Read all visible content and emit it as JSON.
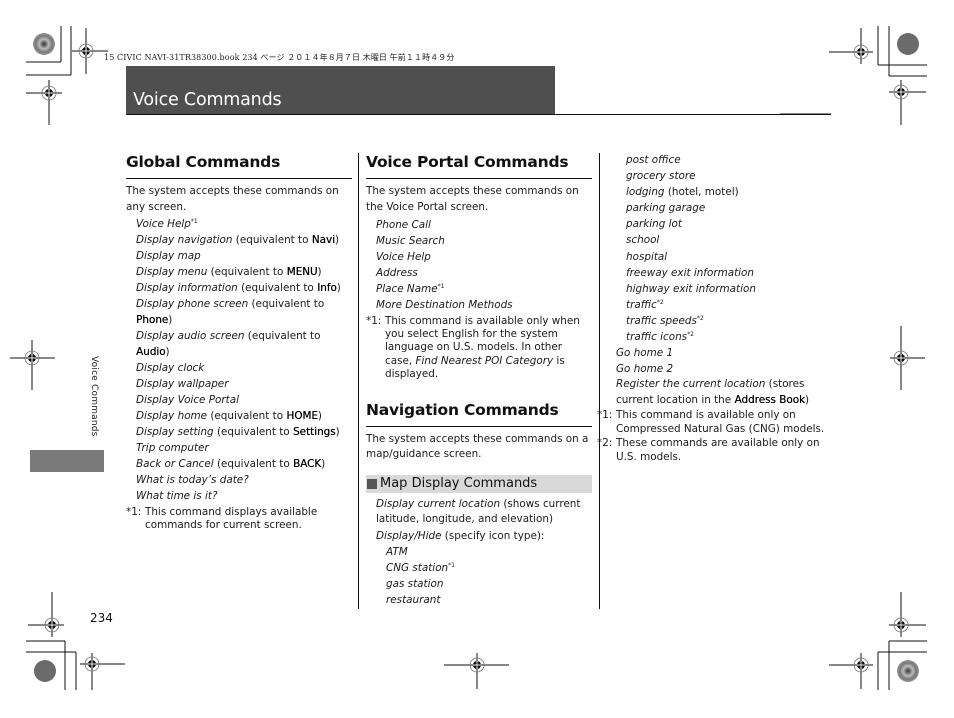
{
  "print_header": "15 CIVIC NAVI-31TR38300.book  234 ページ  ２０１４年８月７日  木曜日  午前１１時４９分",
  "page_title": "Voice Commands",
  "side_tab": "Voice Commands",
  "page_number": "234",
  "global": {
    "heading": "Global Commands",
    "intro": "The system accepts these commands on any screen.",
    "items": [
      {
        "cmd": "Voice Help",
        "sup": "*1",
        "pre": "",
        "key": "",
        "post": ""
      },
      {
        "cmd": "Display navigation",
        "sup": "",
        "pre": " (equivalent to ",
        "key": "Navi",
        "post": ")"
      },
      {
        "cmd": "Display map",
        "sup": "",
        "pre": "",
        "key": "",
        "post": ""
      },
      {
        "cmd": "Display menu",
        "sup": "",
        "pre": " (equivalent to ",
        "key": "MENU",
        "post": ")"
      },
      {
        "cmd": "Display information",
        "sup": "",
        "pre": " (equivalent to ",
        "key": "Info",
        "post": ")"
      },
      {
        "cmd": "Display phone screen",
        "sup": "",
        "pre": " (equivalent to ",
        "key": "Phone",
        "post": ")"
      },
      {
        "cmd": "Display audio screen",
        "sup": "",
        "pre": " (equivalent to ",
        "key": "Audio",
        "post": ")"
      },
      {
        "cmd": "Display clock",
        "sup": "",
        "pre": "",
        "key": "",
        "post": ""
      },
      {
        "cmd": "Display wallpaper",
        "sup": "",
        "pre": "",
        "key": "",
        "post": ""
      },
      {
        "cmd": "Display Voice Portal",
        "sup": "",
        "pre": "",
        "key": "",
        "post": ""
      },
      {
        "cmd": "Display home",
        "sup": "",
        "pre": " (equivalent to ",
        "key": "HOME",
        "post": ")"
      },
      {
        "cmd": "Display setting",
        "sup": "",
        "pre": " (equivalent to ",
        "key": "Settings",
        "post": ")"
      },
      {
        "cmd": "Trip computer",
        "sup": "",
        "pre": "",
        "key": "",
        "post": ""
      },
      {
        "cmd": "Back or Cancel",
        "sup": "",
        "pre": " (equivalent to ",
        "key": "BACK",
        "post": ")"
      },
      {
        "cmd": "What is today’s date?",
        "sup": "",
        "pre": "",
        "key": "",
        "post": ""
      },
      {
        "cmd": "What time is it?",
        "sup": "",
        "pre": "",
        "key": "",
        "post": ""
      }
    ],
    "note_mark": "*1:",
    "note_text": "This command displays available commands for current screen."
  },
  "portal": {
    "heading": "Voice Portal Commands",
    "intro": "The system accepts these commands on the Voice Portal screen.",
    "items": [
      {
        "cmd": "Phone Call",
        "sup": ""
      },
      {
        "cmd": "Music Search",
        "sup": ""
      },
      {
        "cmd": "Voice Help",
        "sup": ""
      },
      {
        "cmd": "Address",
        "sup": ""
      },
      {
        "cmd": "Place Name",
        "sup": "*1"
      },
      {
        "cmd": "More Destination Methods",
        "sup": ""
      }
    ],
    "note_mark": "*1:",
    "note_text_a": "This command is available only when you select English for the system language on U.S. models. In other case, ",
    "note_text_it": "Find Nearest POI Category",
    "note_text_b": " is displayed."
  },
  "navigation": {
    "heading": "Navigation Commands",
    "intro": "The system accepts these commands on a map/guidance screen.",
    "subheading": "Map Display Commands",
    "current_location_cmd": "Display current location",
    "current_location_desc": " (shows current latitude, longitude, and elevation)",
    "display_hide_cmd": "Display/Hide",
    "display_hide_desc": " (specify icon type):",
    "icon_types": [
      {
        "cmd": "ATM",
        "sup": "",
        "desc": ""
      },
      {
        "cmd": "CNG station",
        "sup": "*1",
        "desc": ""
      },
      {
        "cmd": "gas station",
        "sup": "",
        "desc": ""
      },
      {
        "cmd": "restaurant",
        "sup": "",
        "desc": ""
      },
      {
        "cmd": "post office",
        "sup": "",
        "desc": ""
      },
      {
        "cmd": "grocery store",
        "sup": "",
        "desc": ""
      },
      {
        "cmd": "lodging",
        "sup": "",
        "desc": " (hotel, motel)"
      },
      {
        "cmd": "parking garage",
        "sup": "",
        "desc": ""
      },
      {
        "cmd": "parking lot",
        "sup": "",
        "desc": ""
      },
      {
        "cmd": "school",
        "sup": "",
        "desc": ""
      },
      {
        "cmd": "hospital",
        "sup": "",
        "desc": ""
      },
      {
        "cmd": "freeway exit information",
        "sup": "",
        "desc": ""
      },
      {
        "cmd": "highway exit information",
        "sup": "",
        "desc": ""
      },
      {
        "cmd": "traffic",
        "sup": "*2",
        "desc": ""
      },
      {
        "cmd": "traffic speeds",
        "sup": "*2",
        "desc": ""
      },
      {
        "cmd": "traffic icons",
        "sup": "*2",
        "desc": ""
      }
    ],
    "more": [
      {
        "cmd": "Go home 1"
      },
      {
        "cmd": "Go home 2"
      }
    ],
    "register_cmd": "Register the current location",
    "register_pre": " (stores current location in the ",
    "register_key": "Address Book",
    "register_post": ")",
    "notes": [
      {
        "mark": "*1:",
        "text": "This command is available only on Compressed Natural Gas (CNG) models."
      },
      {
        "mark": "*2:",
        "text": "These commands are available only on U.S. models."
      }
    ]
  },
  "colors": {
    "title_bar": "#4f4f4f",
    "subhead_bg": "#d9d9d9",
    "side_tab_block": "#7a7a7a"
  }
}
